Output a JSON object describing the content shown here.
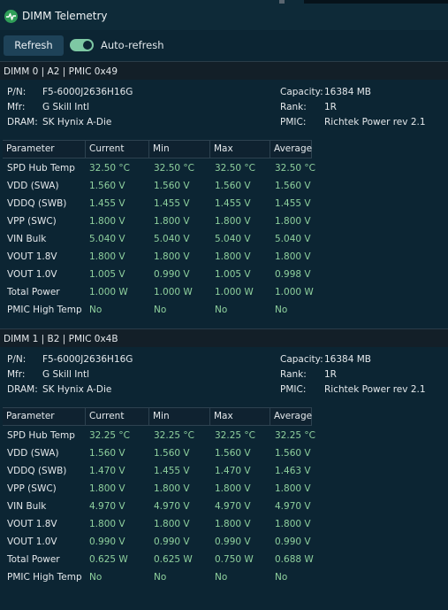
{
  "window": {
    "title": "DIMM Telemetry"
  },
  "toolbar": {
    "refresh_label": "Refresh",
    "auto_refresh_label": "Auto-refresh",
    "auto_refresh_on": true
  },
  "colors": {
    "background": "#0c2533",
    "value_green": "#8fd19e",
    "toggle_on": "#7ec8a4",
    "icon_green": "#2f9e58"
  },
  "columns": [
    "Parameter",
    "Current",
    "Min",
    "Max",
    "Average"
  ],
  "dimms": [
    {
      "header": "DIMM 0 | A2 | PMIC 0x49",
      "pn_label": "P/N:",
      "pn": "F5-6000J2636H16G",
      "mfr_label": "Mfr:",
      "mfr": "G Skill Intl",
      "dram_label": "DRAM:",
      "dram": "SK Hynix A-Die",
      "capacity_label": "Capacity:",
      "capacity": "16384 MB",
      "rank_label": "Rank:",
      "rank": "1R",
      "pmic_label": "PMIC:",
      "pmic": "Richtek Power rev 2.1",
      "rows": [
        [
          "SPD Hub Temp",
          "32.50 °C",
          "32.50 °C",
          "32.50 °C",
          "32.50 °C"
        ],
        [
          "VDD (SWA)",
          "1.560 V",
          "1.560 V",
          "1.560 V",
          "1.560 V"
        ],
        [
          "VDDQ (SWB)",
          "1.455 V",
          "1.455 V",
          "1.455 V",
          "1.455 V"
        ],
        [
          "VPP (SWC)",
          "1.800 V",
          "1.800 V",
          "1.800 V",
          "1.800 V"
        ],
        [
          "VIN Bulk",
          "5.040 V",
          "5.040 V",
          "5.040 V",
          "5.040 V"
        ],
        [
          "VOUT 1.8V",
          "1.800 V",
          "1.800 V",
          "1.800 V",
          "1.800 V"
        ],
        [
          "VOUT 1.0V",
          "1.005 V",
          "0.990 V",
          "1.005 V",
          "0.998 V"
        ],
        [
          "Total Power",
          "1.000 W",
          "1.000 W",
          "1.000 W",
          "1.000 W"
        ],
        [
          "PMIC High Temp",
          "No",
          "No",
          "No",
          "No"
        ]
      ]
    },
    {
      "header": "DIMM 1 | B2 | PMIC 0x4B",
      "pn_label": "P/N:",
      "pn": "F5-6000J2636H16G",
      "mfr_label": "Mfr:",
      "mfr": "G Skill Intl",
      "dram_label": "DRAM:",
      "dram": "SK Hynix A-Die",
      "capacity_label": "Capacity:",
      "capacity": "16384 MB",
      "rank_label": "Rank:",
      "rank": "1R",
      "pmic_label": "PMIC:",
      "pmic": "Richtek Power rev 2.1",
      "rows": [
        [
          "SPD Hub Temp",
          "32.25 °C",
          "32.25 °C",
          "32.25 °C",
          "32.25 °C"
        ],
        [
          "VDD (SWA)",
          "1.560 V",
          "1.560 V",
          "1.560 V",
          "1.560 V"
        ],
        [
          "VDDQ (SWB)",
          "1.470 V",
          "1.455 V",
          "1.470 V",
          "1.463 V"
        ],
        [
          "VPP (SWC)",
          "1.800 V",
          "1.800 V",
          "1.800 V",
          "1.800 V"
        ],
        [
          "VIN Bulk",
          "4.970 V",
          "4.970 V",
          "4.970 V",
          "4.970 V"
        ],
        [
          "VOUT 1.8V",
          "1.800 V",
          "1.800 V",
          "1.800 V",
          "1.800 V"
        ],
        [
          "VOUT 1.0V",
          "0.990 V",
          "0.990 V",
          "0.990 V",
          "0.990 V"
        ],
        [
          "Total Power",
          "0.625 W",
          "0.625 W",
          "0.750 W",
          "0.688 W"
        ],
        [
          "PMIC High Temp",
          "No",
          "No",
          "No",
          "No"
        ]
      ]
    }
  ]
}
